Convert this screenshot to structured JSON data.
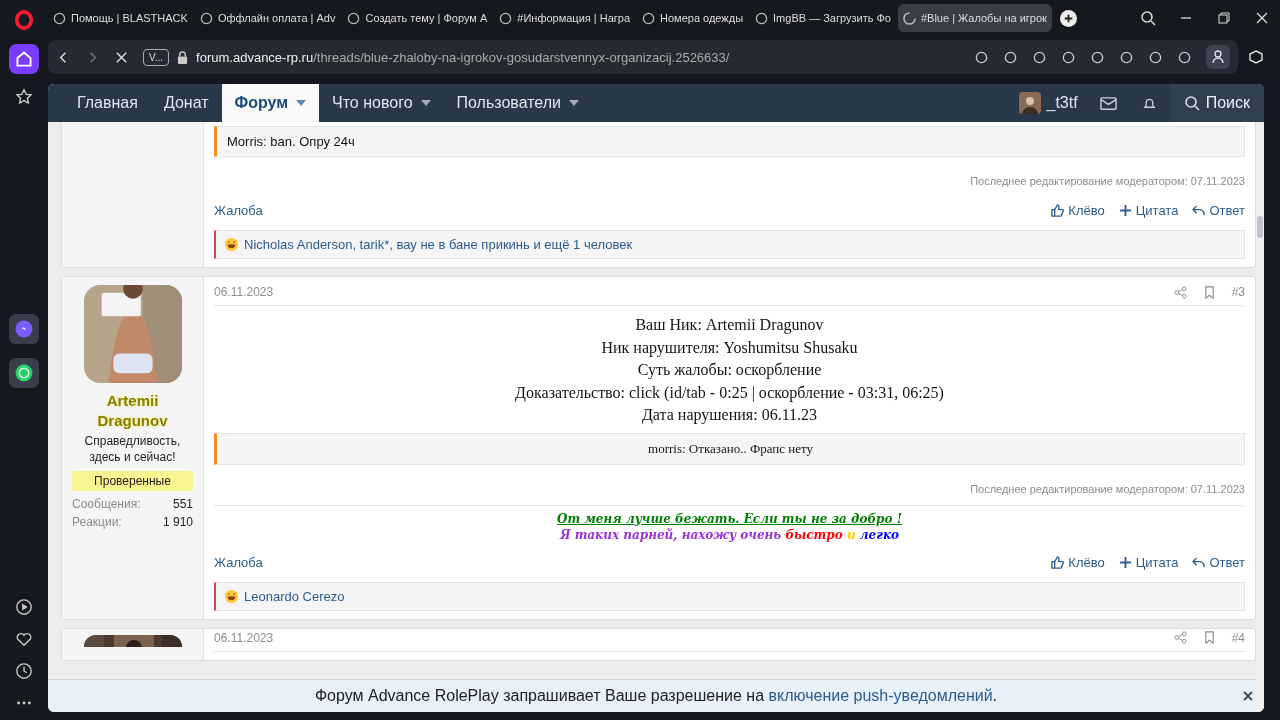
{
  "browser": {
    "tabs": [
      {
        "title": "Помощь | BLASTHACK",
        "selected": false
      },
      {
        "title": "Оффлайн оплата | Adv",
        "selected": false
      },
      {
        "title": "Создать тему | Форум А",
        "selected": false
      },
      {
        "title": "#Информация | Награ",
        "selected": false
      },
      {
        "title": "Номера одежды",
        "selected": false
      },
      {
        "title": "ImgBB — Загрузить Фо",
        "selected": false
      },
      {
        "title": "#Blue | Жалобы на игрок",
        "selected": true
      }
    ],
    "site_chip": "V...",
    "address": {
      "host": "forum.advance-rp.ru",
      "path": "/threads/blue-zhaloby-na-igrokov-gosudarstvennyx-organizacij.2526633/"
    }
  },
  "forum_nav": {
    "items": [
      {
        "label": "Главная",
        "selected": false,
        "has_menu": false
      },
      {
        "label": "Донат",
        "selected": false,
        "has_menu": false
      },
      {
        "label": "Форум",
        "selected": true,
        "has_menu": true
      },
      {
        "label": "Что нового",
        "selected": false,
        "has_menu": true
      },
      {
        "label": "Пользователи",
        "selected": false,
        "has_menu": true
      }
    ],
    "user": "_t3tf",
    "search": "Поиск"
  },
  "posts": [
    {
      "quote": "Morris: ban. Опру 24ч",
      "edit_note": "Последнее редактирование модератором: 07.11.2023",
      "report": "Жалоба",
      "actions": [
        "Клёво",
        "Цитата",
        "Ответ"
      ],
      "reactions": "Nicholas Anderson, tarik*, вау не в бане прикинь и ещё 1 человек"
    },
    {
      "author": {
        "name": "Artemii Dragunov",
        "title": "Справедливость, здесь и сейчас!",
        "group": "Проверенные",
        "stats": [
          {
            "label": "Сообщения:",
            "value": "551"
          },
          {
            "label": "Реакции:",
            "value": "1 910"
          }
        ]
      },
      "date": "06.11.2023",
      "number": "#3",
      "body": [
        "Ваш Ник: Artemii Dragunov",
        "Ник нарушителя: Yoshumitsu Shusaku",
        "Суть жалобы: оскорбление",
        "Доказательство: click (id/tab - 0:25 | оскорбление - 03:31, 06:25)",
        "Дата нарушения: 06.11.23"
      ],
      "quote": "morris: Отказано.. Фрапс нету",
      "edit_note": "Последнее редактирование модератором: 07.11.2023",
      "signature": [
        {
          "underline": true,
          "segments": [
            {
              "text": "От меня лучше бежать. Если ты не за добро !",
              "color": "#008000"
            }
          ]
        },
        {
          "underline": false,
          "segments": [
            {
              "text": "Я таких парней, нахожу очень ",
              "color": "#9b30d9"
            },
            {
              "text": "быстро",
              "color": "#ff0000"
            },
            {
              "text": " и ",
              "color": "#ffd200"
            },
            {
              "text": "легко",
              "color": "#0000ff"
            }
          ]
        }
      ],
      "report": "Жалоба",
      "actions": [
        "Клёво",
        "Цитата",
        "Ответ"
      ],
      "reactions": "Leonardo Cerezo"
    },
    {
      "date": "06.11.2023",
      "number": "#4"
    }
  ],
  "notification": {
    "before": "Форум Advance RolePlay запрашивает Ваше разрешение на ",
    "link": "включение push-уведомлений",
    "after": "."
  }
}
